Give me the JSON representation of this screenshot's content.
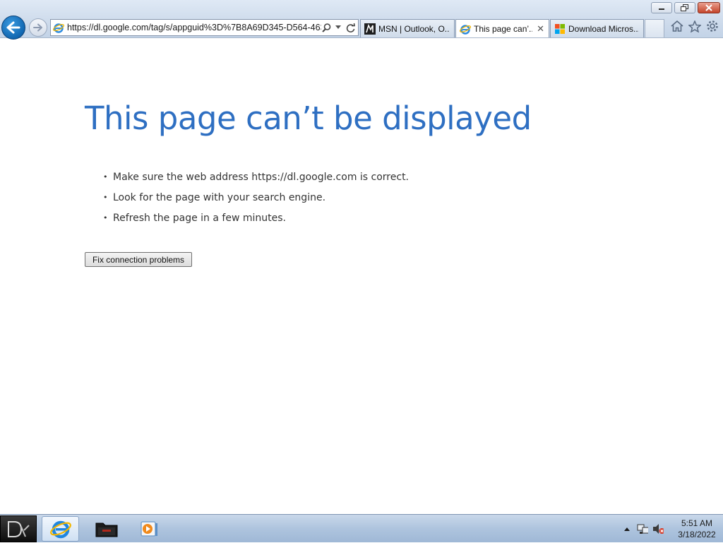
{
  "browser": {
    "address_url": "https://dl.google.com/tag/s/appguid%3D%7B8A69D345-D564-463(",
    "tabs": [
      {
        "label": "MSN | Outlook, O...",
        "icon": "msn-icon",
        "active": false
      },
      {
        "label": "This page can’...",
        "icon": "ie-page-icon",
        "active": true,
        "close": "✕"
      },
      {
        "label": "Download Micros...",
        "icon": "microsoft-logo-icon",
        "active": false
      }
    ],
    "accent": "#1167b1"
  },
  "page": {
    "title": "This page can’t be displayed",
    "title_color": "#2e6fc2",
    "suggestions": [
      "Make sure the web address https://dl.google.com is correct.",
      "Look for the page with your search engine.",
      "Refresh the page in a few minutes."
    ],
    "bullet": "•",
    "fix_button": "Fix connection problems"
  },
  "taskbar": {
    "clock_time": "5:51 AM",
    "clock_date": "3/18/2022",
    "items": [
      "internet-explorer-icon",
      "file-explorer-icon",
      "media-player-icon"
    ]
  }
}
